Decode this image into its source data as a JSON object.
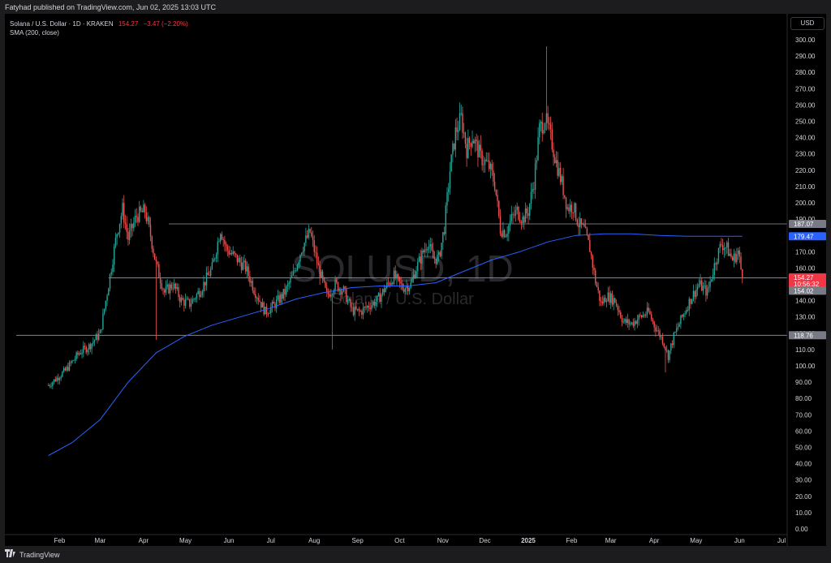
{
  "publisher": "Fatyhad published on TradingView.com, Jun 02, 2025 13:03 UTC",
  "legend": {
    "symbol": "Solana / U.S. Dollar · 1D · KRAKEN",
    "last": "154.27",
    "change": "−3.47 (−2.20%)",
    "indicator": "SMA (200, close)"
  },
  "watermark": {
    "ticker": "SOLUSD, 1D",
    "name": "Solana / U.S. Dollar"
  },
  "currency": "USD",
  "footer": {
    "brand": "TradingView"
  },
  "colors": {
    "up": "#26a69a",
    "down": "#ef5350",
    "sma": "#2962ff",
    "background": "#000000"
  },
  "chart_data": {
    "type": "candlestick",
    "symbol": "SOLUSD",
    "interval": "1D",
    "exchange": "KRAKEN",
    "ylim": [
      0,
      305
    ],
    "y_ticks": [
      "300.00",
      "290.00",
      "280.00",
      "270.00",
      "260.00",
      "250.00",
      "240.00",
      "230.00",
      "220.00",
      "210.00",
      "200.00",
      "190.00",
      "180.00",
      "170.00",
      "160.00",
      "150.00",
      "140.00",
      "130.00",
      "120.00",
      "110.00",
      "100.00",
      "90.00",
      "80.00",
      "70.00",
      "60.00",
      "50.00",
      "40.00",
      "30.00",
      "20.00",
      "10.00",
      "0.00"
    ],
    "x_ticks": [
      {
        "t": 31,
        "label": "Feb"
      },
      {
        "t": 60,
        "label": "Mar"
      },
      {
        "t": 91,
        "label": "Apr"
      },
      {
        "t": 121,
        "label": "May"
      },
      {
        "t": 152,
        "label": "Jun"
      },
      {
        "t": 182,
        "label": "Jul"
      },
      {
        "t": 213,
        "label": "Aug"
      },
      {
        "t": 244,
        "label": "Sep"
      },
      {
        "t": 274,
        "label": "Oct"
      },
      {
        "t": 305,
        "label": "Nov"
      },
      {
        "t": 335,
        "label": "Dec"
      },
      {
        "t": 366,
        "label": "2025"
      },
      {
        "t": 397,
        "label": "Feb"
      },
      {
        "t": 425,
        "label": "Mar"
      },
      {
        "t": 456,
        "label": "Apr"
      },
      {
        "t": 486,
        "label": "May"
      },
      {
        "t": 517,
        "label": "Jun"
      },
      {
        "t": 547,
        "label": "Jul"
      }
    ],
    "candle_range_days": [
      23,
      519
    ],
    "price_path": [
      [
        23,
        88
      ],
      [
        35,
        97
      ],
      [
        45,
        108
      ],
      [
        52,
        112
      ],
      [
        60,
        120
      ],
      [
        66,
        150
      ],
      [
        72,
        182
      ],
      [
        76,
        196
      ],
      [
        80,
        178
      ],
      [
        86,
        192
      ],
      [
        92,
        195
      ],
      [
        96,
        180
      ],
      [
        100,
        162
      ],
      [
        106,
        145
      ],
      [
        112,
        150
      ],
      [
        118,
        140
      ],
      [
        124,
        138
      ],
      [
        132,
        147
      ],
      [
        140,
        160
      ],
      [
        146,
        184
      ],
      [
        150,
        172
      ],
      [
        156,
        167
      ],
      [
        164,
        160
      ],
      [
        170,
        147
      ],
      [
        178,
        133
      ],
      [
        184,
        137
      ],
      [
        192,
        145
      ],
      [
        198,
        156
      ],
      [
        204,
        172
      ],
      [
        210,
        182
      ],
      [
        216,
        160
      ],
      [
        222,
        143
      ],
      [
        228,
        150
      ],
      [
        234,
        146
      ],
      [
        240,
        134
      ],
      [
        246,
        133
      ],
      [
        252,
        137
      ],
      [
        258,
        140
      ],
      [
        264,
        148
      ],
      [
        270,
        155
      ],
      [
        276,
        148
      ],
      [
        282,
        150
      ],
      [
        286,
        160
      ],
      [
        290,
        168
      ],
      [
        294,
        176
      ],
      [
        298,
        166
      ],
      [
        302,
        166
      ],
      [
        306,
        185
      ],
      [
        310,
        220
      ],
      [
        314,
        243
      ],
      [
        318,
        252
      ],
      [
        322,
        233
      ],
      [
        326,
        241
      ],
      [
        332,
        228
      ],
      [
        338,
        222
      ],
      [
        342,
        212
      ],
      [
        346,
        184
      ],
      [
        350,
        182
      ],
      [
        354,
        190
      ],
      [
        358,
        195
      ],
      [
        362,
        190
      ],
      [
        366,
        195
      ],
      [
        370,
        213
      ],
      [
        374,
        245
      ],
      [
        378,
        252
      ],
      [
        382,
        240
      ],
      [
        386,
        225
      ],
      [
        390,
        212
      ],
      [
        394,
        197
      ],
      [
        398,
        198
      ],
      [
        402,
        187
      ],
      [
        406,
        183
      ],
      [
        410,
        172
      ],
      [
        414,
        152
      ],
      [
        418,
        138
      ],
      [
        422,
        143
      ],
      [
        428,
        140
      ],
      [
        434,
        127
      ],
      [
        440,
        126
      ],
      [
        446,
        130
      ],
      [
        452,
        133
      ],
      [
        456,
        125
      ],
      [
        462,
        116
      ],
      [
        466,
        106
      ],
      [
        470,
        118
      ],
      [
        476,
        130
      ],
      [
        482,
        141
      ],
      [
        488,
        150
      ],
      [
        494,
        145
      ],
      [
        500,
        165
      ],
      [
        504,
        175
      ],
      [
        508,
        172
      ],
      [
        512,
        165
      ],
      [
        516,
        170
      ],
      [
        519,
        154
      ]
    ],
    "sma_200": [
      [
        23,
        45
      ],
      [
        40,
        53
      ],
      [
        60,
        67
      ],
      [
        80,
        90
      ],
      [
        100,
        108
      ],
      [
        120,
        118
      ],
      [
        140,
        125
      ],
      [
        160,
        130
      ],
      [
        180,
        135
      ],
      [
        200,
        141
      ],
      [
        220,
        145
      ],
      [
        240,
        148
      ],
      [
        260,
        149
      ],
      [
        280,
        149
      ],
      [
        300,
        151
      ],
      [
        320,
        158
      ],
      [
        340,
        165
      ],
      [
        360,
        170
      ],
      [
        380,
        176
      ],
      [
        400,
        180
      ],
      [
        420,
        181
      ],
      [
        440,
        181
      ],
      [
        460,
        180
      ],
      [
        480,
        179.5
      ],
      [
        500,
        179.5
      ],
      [
        519,
        179.47
      ]
    ],
    "horizontal_lines": [
      {
        "price": 187.07,
        "label": "187.07",
        "from_day": 109
      },
      {
        "price": 154.02,
        "label": "154.02",
        "from_day": 66
      },
      {
        "price": 118.76,
        "label": "118.76",
        "from_day": 0
      }
    ],
    "price_labels": [
      {
        "price": 179.47,
        "label": "179.47",
        "color": "#2962ff"
      },
      {
        "price": 154.27,
        "label": "154.27",
        "sublabel": "10:56:32",
        "color": "#f23645"
      }
    ],
    "wick_extremes": [
      {
        "day": 379,
        "high": 296
      },
      {
        "day": 464,
        "low": 96
      },
      {
        "day": 226,
        "low": 110
      },
      {
        "day": 100,
        "low": 116
      }
    ]
  }
}
